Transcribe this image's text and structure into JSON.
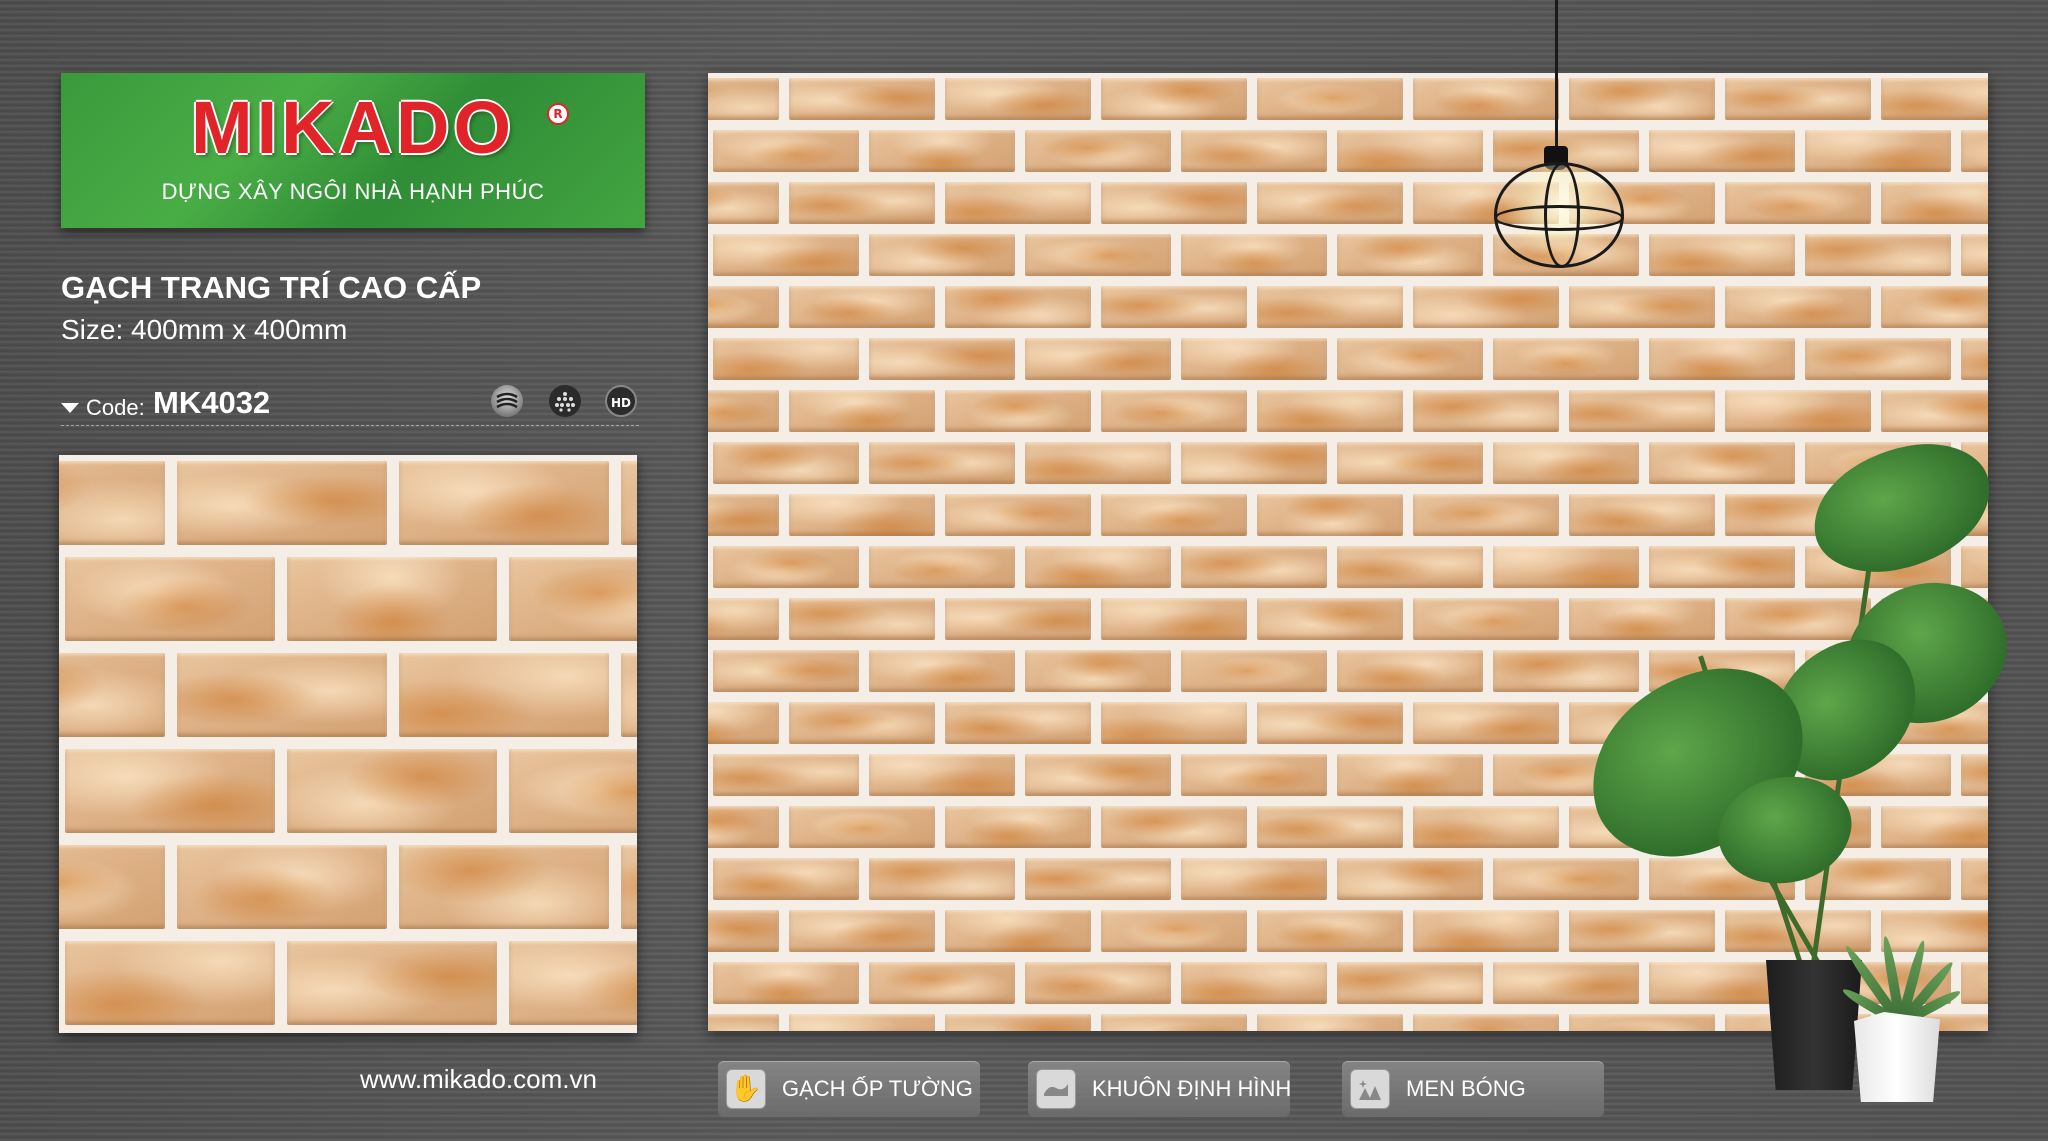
{
  "brand": {
    "name": "MIKADO",
    "registered_mark": "R",
    "slogan": "DỰNG XÂY NGÔI NHÀ HẠNH PHÚC"
  },
  "product": {
    "title": "GẠCH TRANG TRÍ CAO CẤP",
    "size": "Size: 400mm x 400mm",
    "code_label": "Code:",
    "code": "MK4032",
    "feature_icons": [
      "wave-texture-icon",
      "dots-pattern-icon",
      "hd-icon"
    ],
    "hd_badge": "HD"
  },
  "footer": {
    "website": "www.mikado.com.vn",
    "features": [
      {
        "icon": "hand-icon",
        "label": "GẠCH ỐP TƯỜNG"
      },
      {
        "icon": "mold-icon",
        "label": "KHUÔN ĐỊNH HÌNH"
      },
      {
        "icon": "shine-icon",
        "label": "MEN BÓNG"
      }
    ]
  },
  "colors": {
    "brand_red": "#e0242a",
    "banner_green": "#3a9a3c",
    "brick": "#ddb085",
    "mortar": "#f4eee6",
    "background": "#525252"
  }
}
